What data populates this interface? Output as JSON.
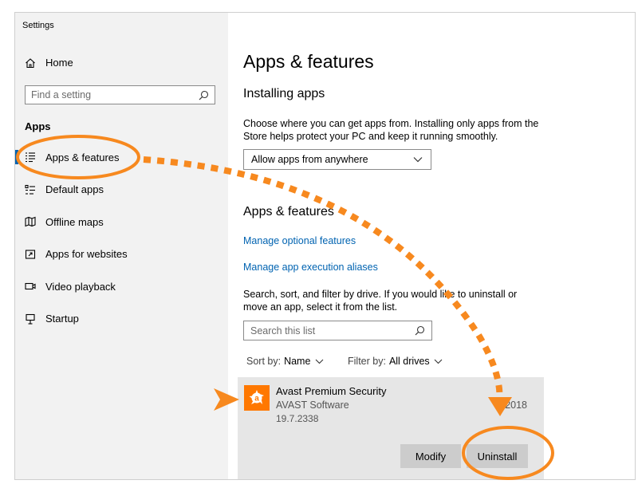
{
  "window": {
    "title": "Settings"
  },
  "sidebar": {
    "home_label": "Home",
    "search_placeholder": "Find a setting",
    "section_label": "Apps",
    "items": [
      {
        "label": "Apps & features",
        "icon": "list-icon",
        "active": true
      },
      {
        "label": "Default apps",
        "icon": "default-apps-icon",
        "active": false
      },
      {
        "label": "Offline maps",
        "icon": "map-icon",
        "active": false
      },
      {
        "label": "Apps for websites",
        "icon": "website-icon",
        "active": false
      },
      {
        "label": "Video playback",
        "icon": "video-icon",
        "active": false
      },
      {
        "label": "Startup",
        "icon": "startup-icon",
        "active": false
      }
    ]
  },
  "main": {
    "title": "Apps & features",
    "installing": {
      "heading": "Installing apps",
      "description": "Choose where you can get apps from. Installing only apps from the Store helps protect your PC and keep it running smoothly.",
      "dropdown_value": "Allow apps from anywhere"
    },
    "apps": {
      "heading": "Apps & features",
      "link_optional": "Manage optional features",
      "link_aliases": "Manage app execution aliases",
      "description": "Search, sort, and filter by drive. If you would like to uninstall or move an app, select it from the list.",
      "search_placeholder": "Search this list",
      "sort_label": "Sort by:",
      "sort_value": "Name",
      "filter_label": "Filter by:",
      "filter_value": "All drives"
    },
    "app_item": {
      "name": "Avast Premium Security",
      "publisher": "AVAST Software",
      "version": "19.7.2338",
      "date": "0/2018",
      "modify_label": "Modify",
      "uninstall_label": "Uninstall"
    }
  },
  "colors": {
    "accent": "#0063b1",
    "annotation": "#f7891f",
    "app_icon": "#ff7800"
  }
}
